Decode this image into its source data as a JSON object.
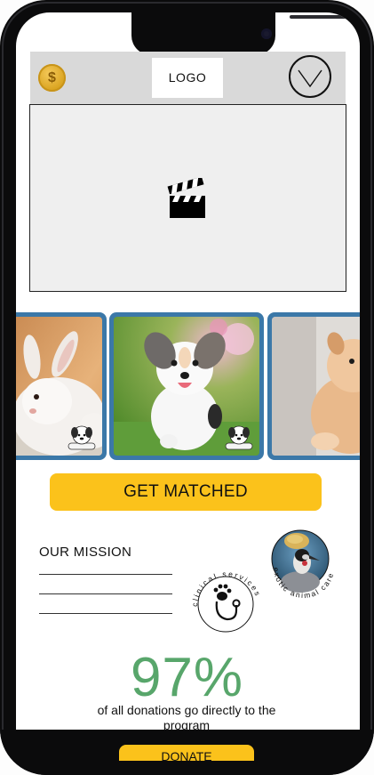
{
  "header": {
    "coin_symbol": "$",
    "logo_label": "LOGO",
    "menu_icon": "chevron-down-icon"
  },
  "video": {
    "icon": "clapperboard-icon"
  },
  "carousel": {
    "cards": [
      {
        "subject": "bunny",
        "badge_icon": "puppy-bone-icon"
      },
      {
        "subject": "puppy",
        "badge_icon": "puppy-bone-icon"
      },
      {
        "subject": "pomeranian"
      }
    ]
  },
  "cta": {
    "label": "GET MATCHED"
  },
  "mission": {
    "title": "OUR MISSION"
  },
  "badges": {
    "clinical": "clinical services",
    "exotic": "exotic animal care"
  },
  "stat": {
    "value": "97%",
    "caption": "of all donations go directly to the program"
  },
  "donate": {
    "label": "DONATE"
  },
  "colors": {
    "accent": "#fbc21b",
    "card_border": "#3b78a8",
    "stat_green": "#58a66b",
    "header_gray": "#d9d9d9"
  }
}
